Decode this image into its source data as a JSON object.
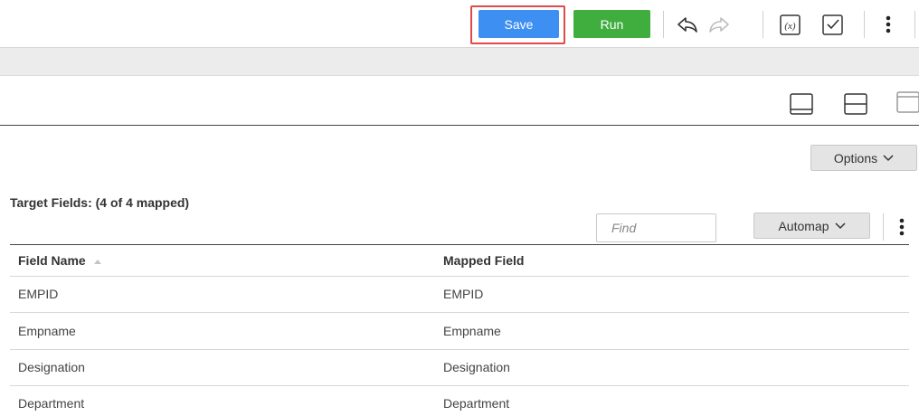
{
  "toolbar": {
    "save_label": "Save",
    "run_label": "Run",
    "colors": {
      "save": "#3d8ff2",
      "run": "#3fae3f",
      "highlight": "#e04a4a"
    },
    "icons": [
      "undo-icon",
      "redo-icon",
      "function-icon",
      "validate-icon",
      "more-vertical-icon"
    ]
  },
  "panel": {
    "options_label": "Options",
    "layout_icons": [
      "layout-bottom-panel-icon",
      "layout-split-horizontal-icon",
      "layout-top-panel-icon"
    ]
  },
  "target": {
    "title": "Target Fields: (4 of 4 mapped)",
    "find_placeholder": "Find",
    "automap_label": "Automap"
  },
  "table": {
    "headers": {
      "field_name": "Field Name",
      "mapped_field": "Mapped Field"
    },
    "rows": [
      {
        "field_name": "EMPID",
        "mapped_field": "EMPID"
      },
      {
        "field_name": "Empname",
        "mapped_field": "Empname"
      },
      {
        "field_name": "Designation",
        "mapped_field": "Designation"
      },
      {
        "field_name": "Department",
        "mapped_field": "Department"
      }
    ]
  }
}
